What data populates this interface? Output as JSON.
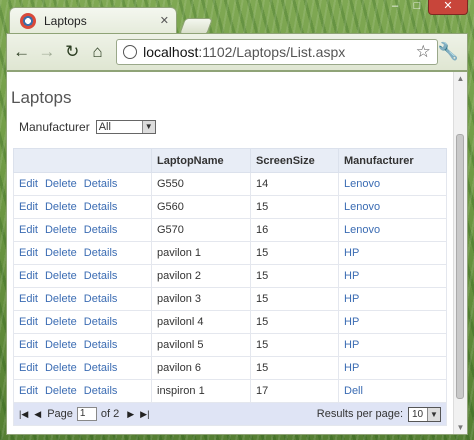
{
  "browser": {
    "tab_title": "Laptops",
    "url_host": "localhost",
    "url_path": ":1102/Laptops/List.aspx",
    "window_buttons": [
      "–",
      "□",
      "✕"
    ]
  },
  "page": {
    "title": "Laptops",
    "filter_label": "Manufacturer",
    "filter_value": "All"
  },
  "grid": {
    "headers": [
      "",
      "LaptopName",
      "ScreenSize",
      "Manufacturer"
    ],
    "actions": [
      "Edit",
      "Delete",
      "Details"
    ],
    "rows": [
      {
        "name": "G550",
        "size": "14",
        "manufacturer": "Lenovo"
      },
      {
        "name": "G560",
        "size": "15",
        "manufacturer": "Lenovo"
      },
      {
        "name": "G570",
        "size": "16",
        "manufacturer": "Lenovo"
      },
      {
        "name": "pavilon 1",
        "size": "15",
        "manufacturer": "HP"
      },
      {
        "name": "pavilon 2",
        "size": "15",
        "manufacturer": "HP"
      },
      {
        "name": "pavilon 3",
        "size": "15",
        "manufacturer": "HP"
      },
      {
        "name": "pavilonl 4",
        "size": "15",
        "manufacturer": "HP"
      },
      {
        "name": "pavilonl 5",
        "size": "15",
        "manufacturer": "HP"
      },
      {
        "name": "pavilon 6",
        "size": "15",
        "manufacturer": "HP"
      },
      {
        "name": "inspiron 1",
        "size": "17",
        "manufacturer": "Dell"
      }
    ]
  },
  "pager": {
    "page_label": "Page",
    "page_value": "1",
    "of_label": "of 2",
    "results_label": "Results per page:",
    "results_value": "10"
  }
}
